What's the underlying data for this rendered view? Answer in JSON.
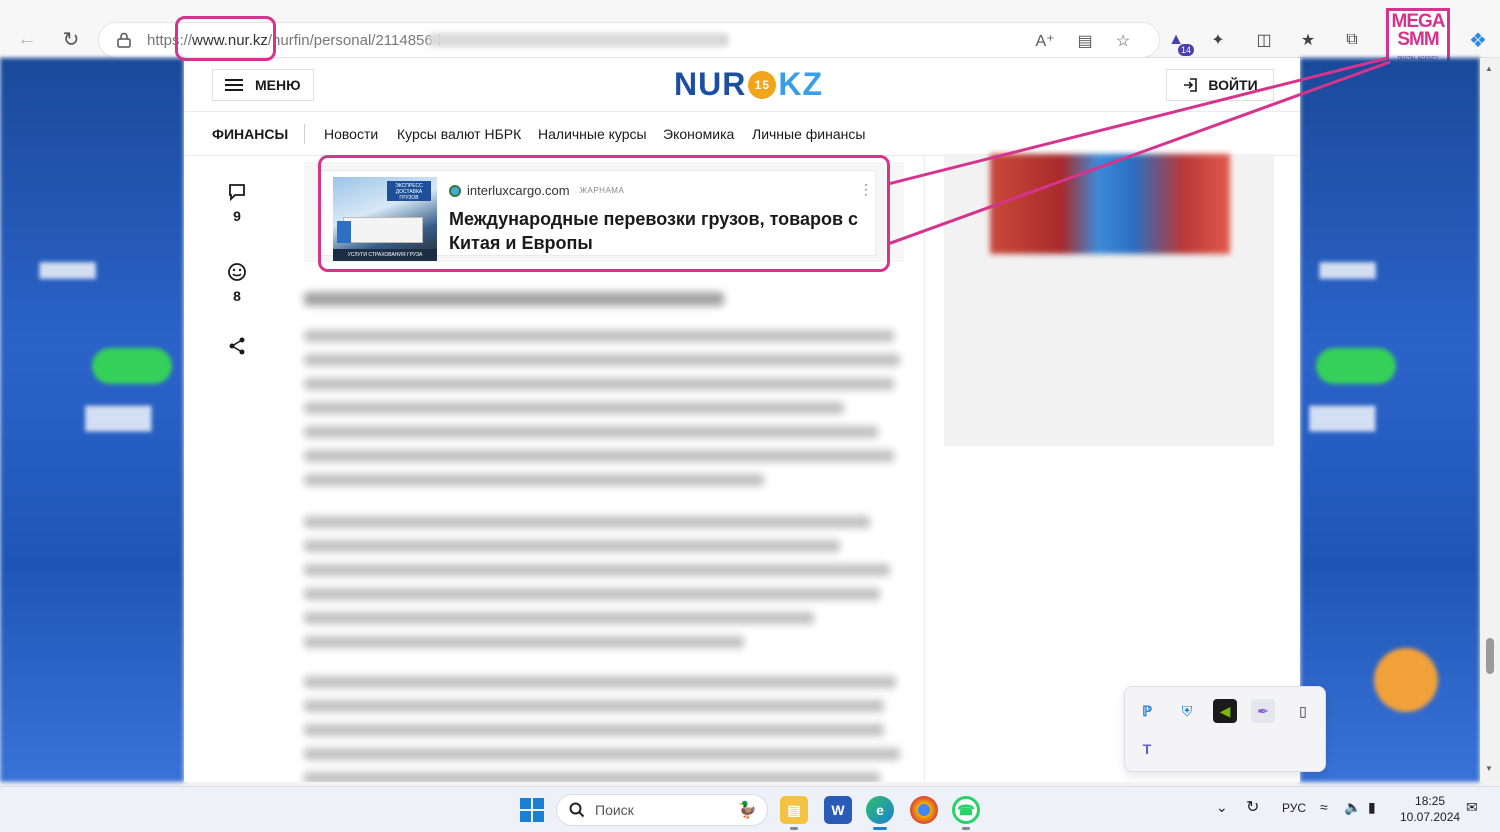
{
  "browser": {
    "url_prefix": "https://",
    "url_domain": "www.nur.kz",
    "url_path": "/nurfin/personal/2114856-i"
  },
  "agency_logo": {
    "line1": "MEGA",
    "line2": "SMM",
    "tagline": "DIGITAL AGENCY"
  },
  "extension_badge": "14",
  "site": {
    "menu_label": "МЕНЮ",
    "logo_left": "NUR",
    "logo_mid": "15",
    "logo_right": "KZ",
    "login_label": "ВОЙТИ"
  },
  "subnav": {
    "category": "ФИНАНСЫ",
    "items": [
      "Новости",
      "Курсы валют НБРК",
      "Наличные курсы",
      "Экономика",
      "Личные финансы"
    ]
  },
  "article_actions": {
    "comments_count": "9",
    "reactions_count": "8"
  },
  "ad": {
    "source": "interluxcargo.com",
    "label": "ЖАРНАМА",
    "title": "Международные перевозки грузов, товаров с Китая и Европы",
    "image_tag": "ЭКСПРЕСС ДОСТАВКА ГРУЗОВ",
    "image_bar": "УСЛУГИ СТРАХОВАНИЯ ГРУЗА"
  },
  "taskbar": {
    "search_placeholder": "Поиск",
    "language": "РУС",
    "time": "18:25",
    "date": "10.07.2024"
  },
  "colors": {
    "highlight": "#d6338c",
    "brand_blue": "#1c4fa1",
    "brand_orange": "#f2a51a"
  }
}
